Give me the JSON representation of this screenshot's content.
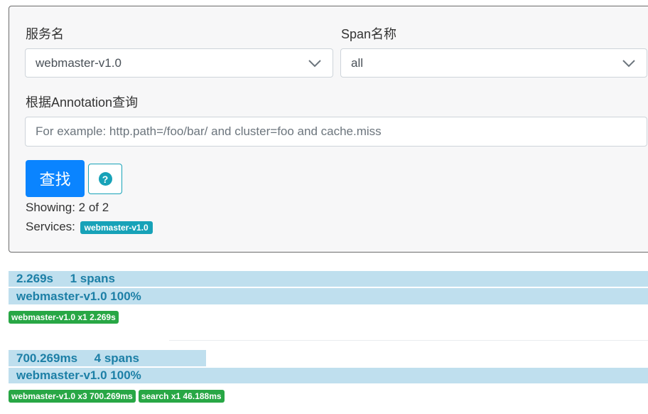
{
  "form": {
    "service_label": "服务名",
    "service_value": "webmaster-v1.0",
    "span_label": "Span名称",
    "span_value": "all",
    "annotation_label": "根据Annotation查询",
    "annotation_placeholder": "For example: http.path=/foo/bar/ and cluster=foo and cache.miss",
    "search_button": "查找",
    "help_glyph": "?",
    "showing_text": "Showing: 2 of 2",
    "services_label": "Services:",
    "services_badge": "webmaster-v1.0"
  },
  "traces": [
    {
      "duration_text": "2.269s     1 spans",
      "duration_fraction": 1.0,
      "service_text": "webmaster-v1.0 100%",
      "badges": [
        "webmaster-v1.0 x1 2.269s"
      ]
    },
    {
      "duration_text": "700.269ms     4 spans",
      "duration_fraction": 0.3086,
      "service_text": "webmaster-v1.0 100%",
      "badges": [
        "webmaster-v1.0 x3 700.269ms",
        "search x1 46.188ms"
      ]
    }
  ],
  "icons": {
    "dropdown": "chevron-down-icon",
    "help": "question-circle-icon"
  },
  "colors": {
    "primary": "#0a84ff",
    "info": "#17a2b8",
    "success": "#28a745",
    "trace_bar": "#bfdfee",
    "trace_text": "#1c7fa6"
  }
}
